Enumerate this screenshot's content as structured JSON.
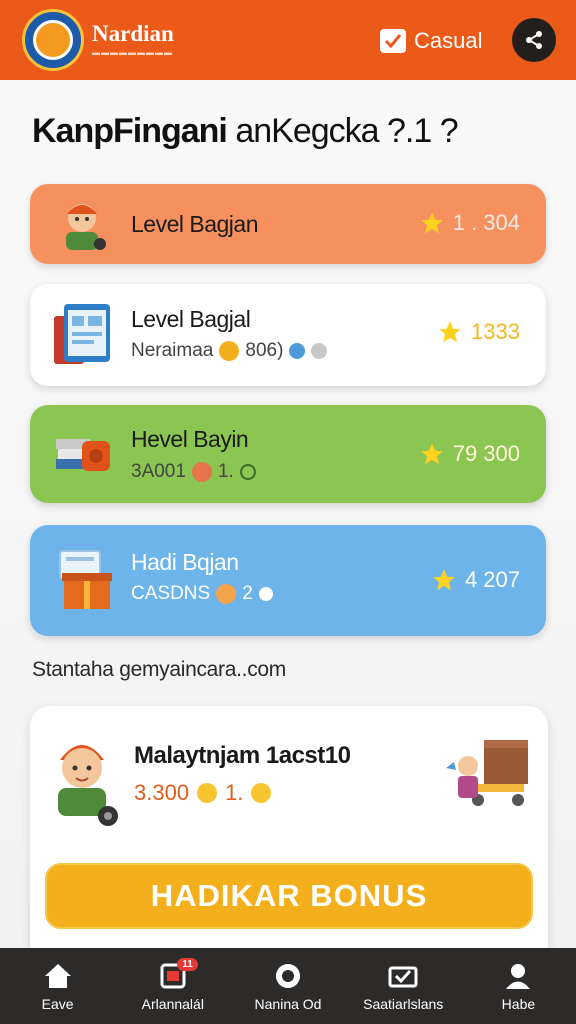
{
  "header": {
    "brand_name": "Nardian",
    "mode_label": "Casual",
    "colors": {
      "bar": "#ec5a1a"
    }
  },
  "page": {
    "title_bold": "KanpFingani",
    "title_rest": "anKegcka ?.1 ?"
  },
  "levels": [
    {
      "title": "Level Bagjan",
      "score": "1 . 304",
      "icon": "worker-avatar-icon",
      "color": "#f6915f"
    },
    {
      "title": "Level Bagjal",
      "subtitle": "Neraimaa",
      "sub_value": "806)",
      "score": "1333",
      "icon": "tablet-icon",
      "color": "#ffffff"
    },
    {
      "title": "Hevel Bayin",
      "subtitle": "3A001",
      "sub_value": "1.",
      "score": "79 300",
      "icon": "books-icon",
      "color": "#8bc653"
    },
    {
      "title": "Hadi Bqjan",
      "subtitle": "CASDNS",
      "sub_value": "2",
      "score": "4 207",
      "icon": "gift-box-icon",
      "color": "#6cb4ea"
    }
  ],
  "section_caption": "Stantaha gemyaincara..com",
  "bonus": {
    "title": "Malaytnjam 1acst10",
    "value": "3.300",
    "count": "1.",
    "button_label": "HADIKAR BONUS",
    "button_color": "#f4b01c"
  },
  "nav": [
    {
      "label": "Eave",
      "icon": "home-icon"
    },
    {
      "label": "Arlannalál",
      "icon": "calendar-icon",
      "badge": "11"
    },
    {
      "label": "Nanina Od",
      "icon": "chat-icon"
    },
    {
      "label": "Saatiarlslans",
      "icon": "ticket-icon"
    },
    {
      "label": "Habe",
      "icon": "profile-icon"
    }
  ]
}
